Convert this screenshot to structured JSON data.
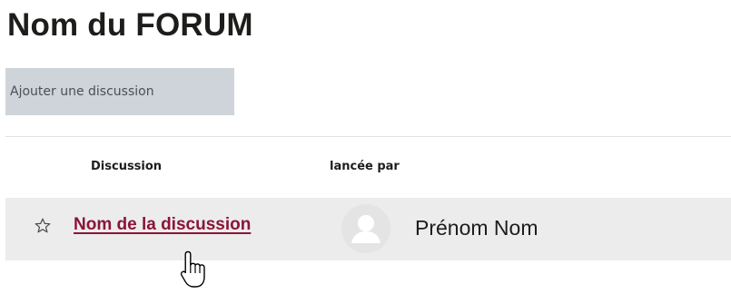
{
  "forum": {
    "title": "Nom du FORUM",
    "add_button_label": "Ajouter une discussion"
  },
  "table": {
    "columns": [
      "Discussion",
      "lancée par"
    ],
    "rows": [
      {
        "discussion": "Nom de la discussion",
        "started_by": "Prénom Nom",
        "star_icon": "star-outline-icon",
        "avatar_icon": "user-avatar-placeholder-icon"
      }
    ]
  },
  "pointer": {
    "icon": "hand-pointer-cursor-icon"
  },
  "colors": {
    "link": "#8b1538",
    "button_bg": "#ced4da",
    "row_bg": "#ececec"
  }
}
